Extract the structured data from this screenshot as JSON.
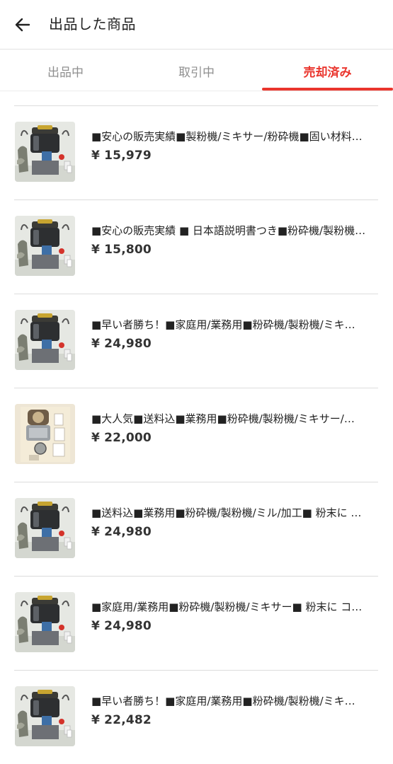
{
  "header": {
    "title": "出品した商品"
  },
  "tabs": [
    {
      "label": "出品中",
      "active": false
    },
    {
      "label": "取引中",
      "active": false
    },
    {
      "label": "売却済み",
      "active": true
    }
  ],
  "colors": {
    "accent": "#ea352d"
  },
  "items": [
    {
      "title": "■安心の販売実績■製粉機/ミキサー/粉砕機■固い材料…",
      "price": "¥ 15,979",
      "image": "grinder-photo"
    },
    {
      "title": "■安心の販売実績 ■ 日本語説明書つき■粉砕機/製粉機…",
      "price": "¥ 15,800",
      "image": "grinder-photo"
    },
    {
      "title": "■早い者勝ち！■家庭用/業務用■粉砕機/製粉機/ミキ…",
      "price": "¥ 24,980",
      "image": "grinder-photo"
    },
    {
      "title": "■大人気■送料込■業務用■粉砕機/製粉機/ミキサー/…",
      "price": "¥ 22,000",
      "image": "grinder-photo-alt"
    },
    {
      "title": "■送料込■業務用■粉砕機/製粉機/ミル/加工■ 粉末に …",
      "price": "¥ 24,980",
      "image": "grinder-photo"
    },
    {
      "title": "■家庭用/業務用■粉砕機/製粉機/ミキサー■ 粉末に コ…",
      "price": "¥ 24,980",
      "image": "grinder-photo"
    },
    {
      "title": "■早い者勝ち！■家庭用/業務用■粉砕機/製粉機/ミキ…",
      "price": "¥ 22,482",
      "image": "grinder-photo"
    }
  ]
}
